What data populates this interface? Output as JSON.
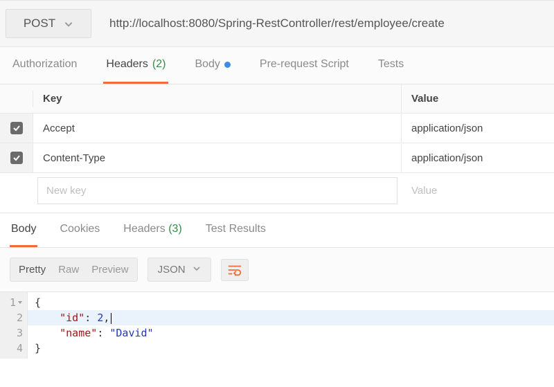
{
  "request": {
    "method": "POST",
    "url": "http://localhost:8080/Spring-RestController/rest/employee/create"
  },
  "request_tabs": {
    "authorization": "Authorization",
    "headers": "Headers",
    "headers_count": "(2)",
    "body": "Body",
    "prerequest": "Pre-request Script",
    "tests": "Tests"
  },
  "headers_table": {
    "col_key": "Key",
    "col_value": "Value",
    "rows": [
      {
        "key": "Accept",
        "value": "application/json",
        "checked": true
      },
      {
        "key": "Content-Type",
        "value": "application/json",
        "checked": true
      }
    ],
    "new_key_placeholder": "New key",
    "new_value_placeholder": "Value"
  },
  "response_tabs": {
    "body": "Body",
    "cookies": "Cookies",
    "headers": "Headers",
    "headers_count": "(3)",
    "test_results": "Test Results"
  },
  "viewer": {
    "pretty": "Pretty",
    "raw": "Raw",
    "preview": "Preview",
    "format": "JSON"
  },
  "body_json": {
    "line1": "{",
    "line2_key": "\"id\"",
    "line2_punc": ": ",
    "line2_val": "2",
    "line2_end": ",",
    "line3_key": "\"name\"",
    "line3_punc": ": ",
    "line3_val": "\"David\"",
    "line4": "}"
  },
  "gutter": {
    "l1": "1",
    "l2": "2",
    "l3": "3",
    "l4": "4"
  }
}
